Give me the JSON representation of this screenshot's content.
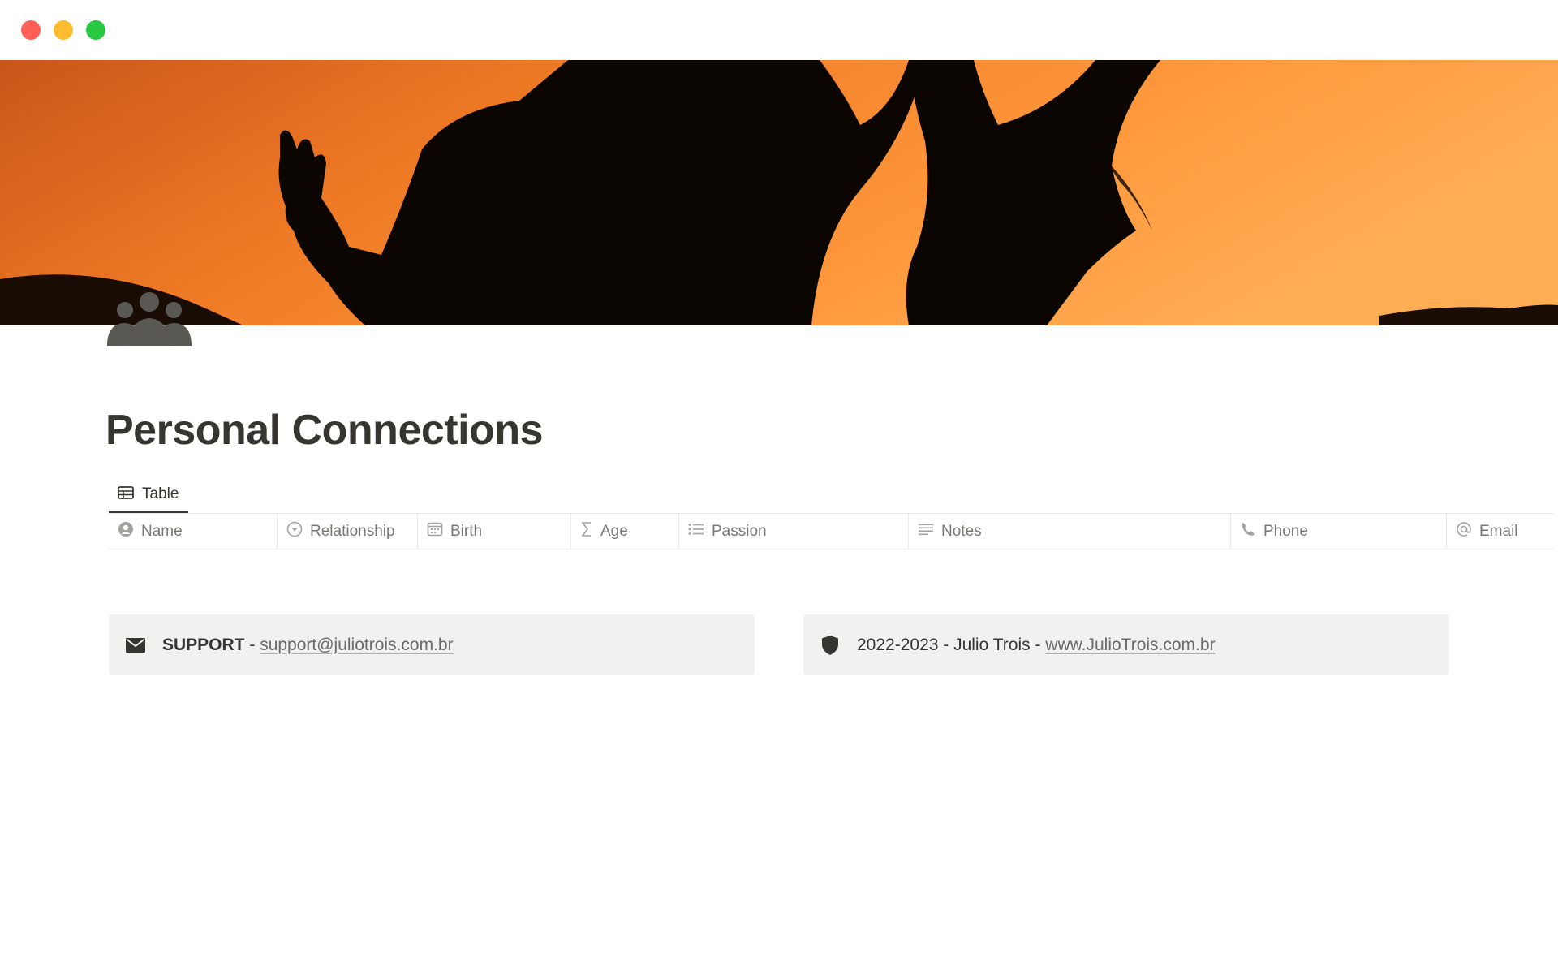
{
  "window": {
    "controls": [
      "close",
      "minimize",
      "maximize"
    ]
  },
  "page": {
    "title": "Personal Connections",
    "icon": "people-group-icon",
    "cover": "sunset-silhouettes-cover"
  },
  "views": [
    {
      "label": "Table",
      "icon": "table-icon"
    }
  ],
  "table": {
    "columns": [
      {
        "label": "Name",
        "icon": "person-icon"
      },
      {
        "label": "Relationship",
        "icon": "select-icon"
      },
      {
        "label": "Birth",
        "icon": "calendar-icon"
      },
      {
        "label": "Age",
        "icon": "sigma-icon"
      },
      {
        "label": "Passion",
        "icon": "list-icon"
      },
      {
        "label": "Notes",
        "icon": "text-lines-icon"
      },
      {
        "label": "Phone",
        "icon": "phone-icon"
      },
      {
        "label": "Email",
        "icon": "at-icon"
      }
    ]
  },
  "callouts": {
    "support": {
      "icon": "envelope-icon",
      "label": "SUPPORT",
      "separator": " - ",
      "link": "support@juliotrois.com.br"
    },
    "credit": {
      "icon": "shield-icon",
      "text": "2022-2023 - Julio Trois - ",
      "link": "www.JulioTrois.com.br"
    }
  },
  "colors": {
    "text": "#37352f",
    "muted": "#787774",
    "callout_bg": "#f1f1ef",
    "cover_orange": "#f28a2e"
  }
}
